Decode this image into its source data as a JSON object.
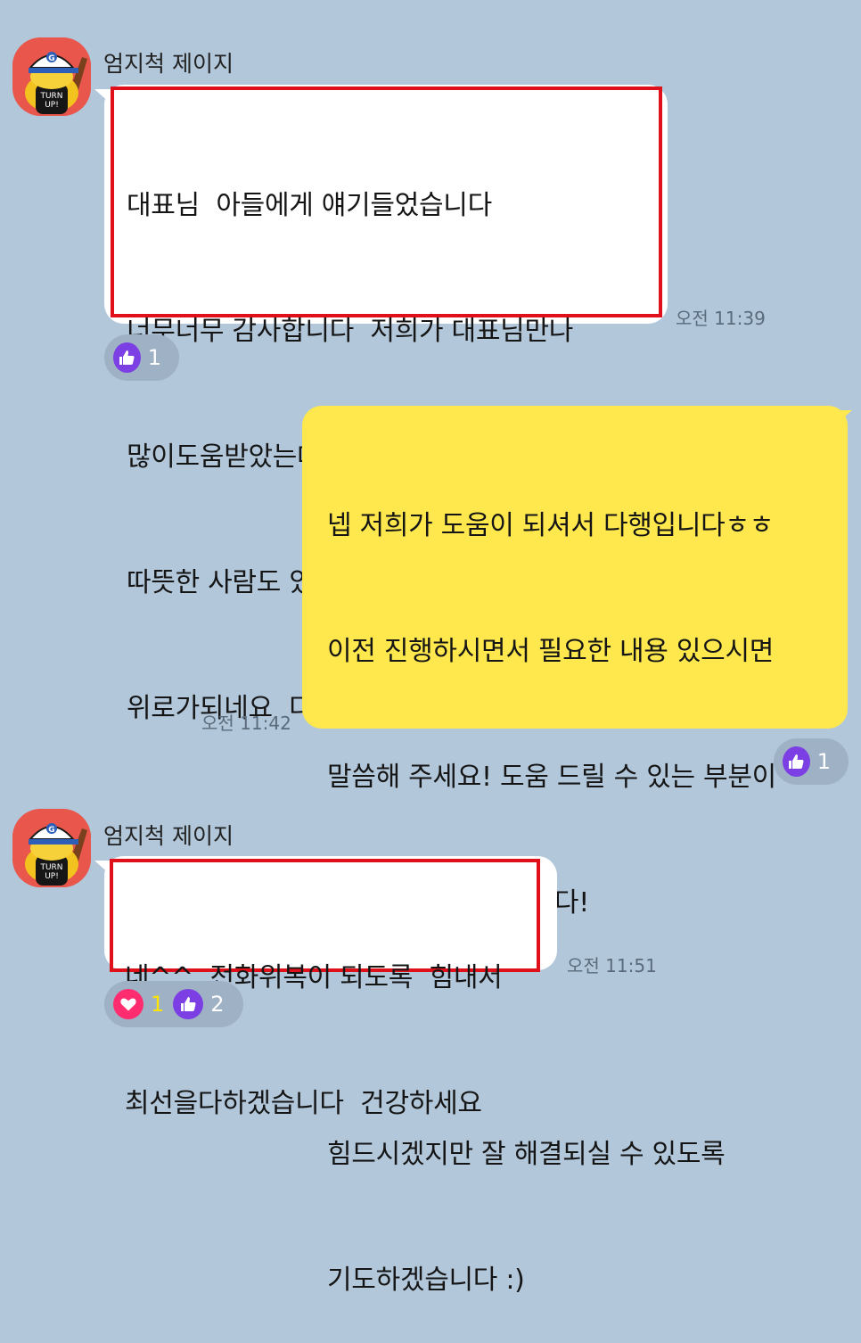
{
  "messages": [
    {
      "sender": "엄지척 제이지",
      "lines": [
        "대표님  아들에게 얘기들었습니다",
        "너무너무 감사합니다  저희가 대표님만나",
        "많이도움받았는데  면목이없습니다  세상엔",
        "따뜻한 사람도 있다는걸 새삼느끼며",
        "위로가되네요  다시한번 감사드립니다"
      ],
      "time": "오전 11:39",
      "reactions": [
        {
          "icon": "thumbs-up-icon",
          "count": "1"
        }
      ]
    },
    {
      "lines": [
        "넵 저희가 도움이 되셔서 다행입니다ㅎㅎ",
        "이전 진행하시면서 필요한 내용 있으시면",
        "말씀해 주세요! 도움 드릴 수 있는 부분이",
        "있는지 살펴보겠습니다!",
        "",
        "힘드시겠지만 잘 해결되실 수 있도록",
        "기도하겠습니다 :)"
      ],
      "time": "오전 11:42",
      "reactions": [
        {
          "icon": "thumbs-up-icon",
          "count": "1"
        }
      ]
    },
    {
      "sender": "엄지척 제이지",
      "lines": [
        "네^^  전화위복이 되도록  힘내서",
        "최선을다하겠습니다  건강하세요"
      ],
      "time": "오전 11:51",
      "reactions": [
        {
          "icon": "heart-icon",
          "count": "1"
        },
        {
          "icon": "thumbs-up-icon",
          "count": "2"
        }
      ]
    }
  ],
  "colors": {
    "background": "#b2c7da",
    "incoming_bubble": "#ffffff",
    "outgoing_bubble": "#fee84d",
    "highlight_border": "#e0101a",
    "like_reaction": "#7b3fe4",
    "heart_reaction": "#ff2d6f"
  }
}
